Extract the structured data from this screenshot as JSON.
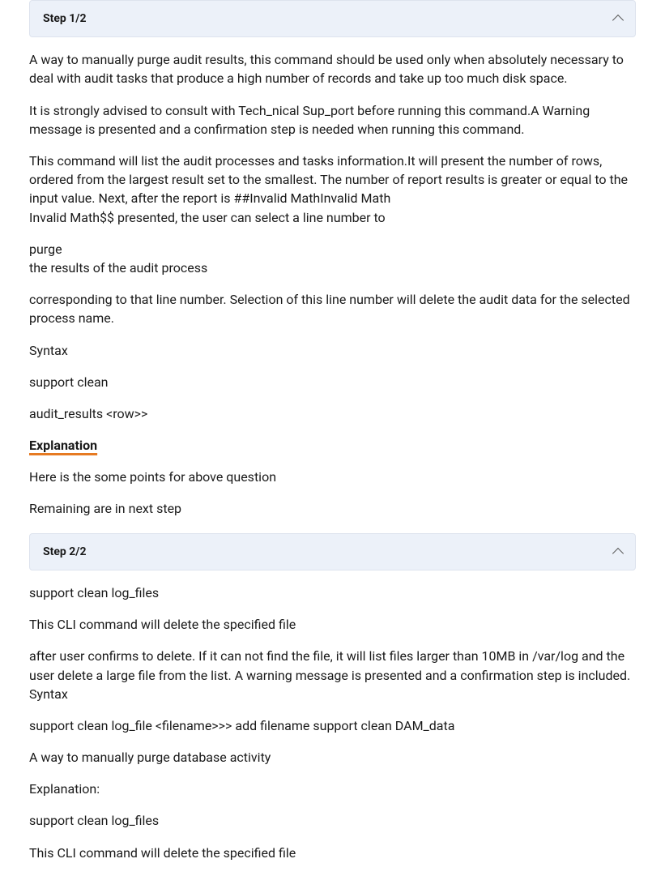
{
  "step1": {
    "title": "Step 1/2",
    "para1": "A way to manually purge audit results, this command should be used only when absolutely necessary to deal with audit tasks that produce a high number of records and take up too much disk space.",
    "para2": "It is strongly advised to consult with Tech_nical Sup_port before running this command.A Warning message is presented and a confirmation step is needed when running this command.",
    "para3_line1": "This command will list the audit processes and tasks information.It will present the number of rows, ordered from the largest result set to the smallest. The number of report results is greater or equal to the input value. Next, after the report is ##Invalid MathInvalid Math",
    "para3_line2": "Invalid Math$$ presented, the user can select a line number to",
    "purge_line1": "purge",
    "purge_line2": "the results of the audit process",
    "para5": "corresponding to that line number. Selection of this line number will delete the audit data for the selected process name.",
    "syntax_label": "Syntax",
    "syntax_cmd1": "support clean",
    "syntax_cmd2": "audit_results <row>>",
    "explanation_label": "Explanation",
    "explanation_p1": "Here is the some points for above question",
    "explanation_p2": "Remaining are in next step"
  },
  "step2": {
    "title": "Step 2/2",
    "p1": "support clean log_files",
    "p2": "This CLI command will delete the specified file",
    "p3": "after user confirms to delete. If it can not find the file, it will list files larger than 10MB in /var/log and the user delete a large file from the list. A warning message is presented and a confirmation step is included. Syntax",
    "p4": "support clean log_file <filename>>> add filename support clean DAM_data",
    "p5": "A way to manually purge database activity",
    "p6": "Explanation:",
    "p7": "support clean log_files",
    "p8": "This CLI command will delete the specified file"
  }
}
